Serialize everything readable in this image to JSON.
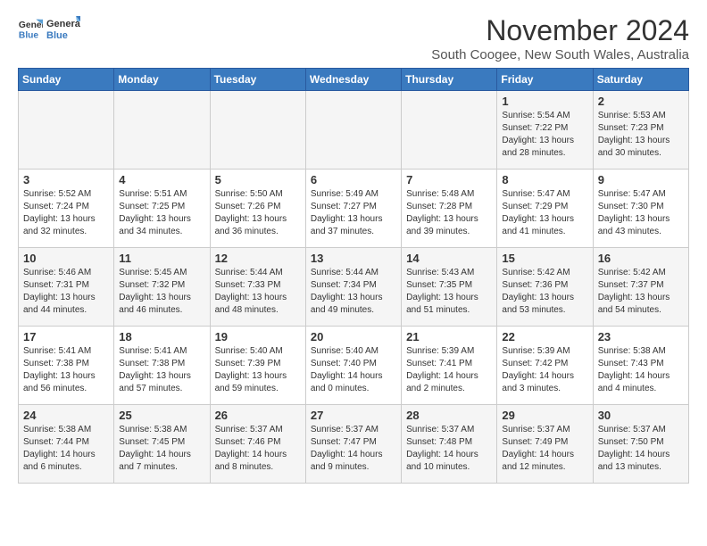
{
  "logo": {
    "general": "General",
    "blue": "Blue"
  },
  "title": "November 2024",
  "subtitle": "South Coogee, New South Wales, Australia",
  "days_of_week": [
    "Sunday",
    "Monday",
    "Tuesday",
    "Wednesday",
    "Thursday",
    "Friday",
    "Saturday"
  ],
  "weeks": [
    [
      {
        "day": "",
        "info": ""
      },
      {
        "day": "",
        "info": ""
      },
      {
        "day": "",
        "info": ""
      },
      {
        "day": "",
        "info": ""
      },
      {
        "day": "",
        "info": ""
      },
      {
        "day": "1",
        "info": "Sunrise: 5:54 AM\nSunset: 7:22 PM\nDaylight: 13 hours\nand 28 minutes."
      },
      {
        "day": "2",
        "info": "Sunrise: 5:53 AM\nSunset: 7:23 PM\nDaylight: 13 hours\nand 30 minutes."
      }
    ],
    [
      {
        "day": "3",
        "info": "Sunrise: 5:52 AM\nSunset: 7:24 PM\nDaylight: 13 hours\nand 32 minutes."
      },
      {
        "day": "4",
        "info": "Sunrise: 5:51 AM\nSunset: 7:25 PM\nDaylight: 13 hours\nand 34 minutes."
      },
      {
        "day": "5",
        "info": "Sunrise: 5:50 AM\nSunset: 7:26 PM\nDaylight: 13 hours\nand 36 minutes."
      },
      {
        "day": "6",
        "info": "Sunrise: 5:49 AM\nSunset: 7:27 PM\nDaylight: 13 hours\nand 37 minutes."
      },
      {
        "day": "7",
        "info": "Sunrise: 5:48 AM\nSunset: 7:28 PM\nDaylight: 13 hours\nand 39 minutes."
      },
      {
        "day": "8",
        "info": "Sunrise: 5:47 AM\nSunset: 7:29 PM\nDaylight: 13 hours\nand 41 minutes."
      },
      {
        "day": "9",
        "info": "Sunrise: 5:47 AM\nSunset: 7:30 PM\nDaylight: 13 hours\nand 43 minutes."
      }
    ],
    [
      {
        "day": "10",
        "info": "Sunrise: 5:46 AM\nSunset: 7:31 PM\nDaylight: 13 hours\nand 44 minutes."
      },
      {
        "day": "11",
        "info": "Sunrise: 5:45 AM\nSunset: 7:32 PM\nDaylight: 13 hours\nand 46 minutes."
      },
      {
        "day": "12",
        "info": "Sunrise: 5:44 AM\nSunset: 7:33 PM\nDaylight: 13 hours\nand 48 minutes."
      },
      {
        "day": "13",
        "info": "Sunrise: 5:44 AM\nSunset: 7:34 PM\nDaylight: 13 hours\nand 49 minutes."
      },
      {
        "day": "14",
        "info": "Sunrise: 5:43 AM\nSunset: 7:35 PM\nDaylight: 13 hours\nand 51 minutes."
      },
      {
        "day": "15",
        "info": "Sunrise: 5:42 AM\nSunset: 7:36 PM\nDaylight: 13 hours\nand 53 minutes."
      },
      {
        "day": "16",
        "info": "Sunrise: 5:42 AM\nSunset: 7:37 PM\nDaylight: 13 hours\nand 54 minutes."
      }
    ],
    [
      {
        "day": "17",
        "info": "Sunrise: 5:41 AM\nSunset: 7:38 PM\nDaylight: 13 hours\nand 56 minutes."
      },
      {
        "day": "18",
        "info": "Sunrise: 5:41 AM\nSunset: 7:38 PM\nDaylight: 13 hours\nand 57 minutes."
      },
      {
        "day": "19",
        "info": "Sunrise: 5:40 AM\nSunset: 7:39 PM\nDaylight: 13 hours\nand 59 minutes."
      },
      {
        "day": "20",
        "info": "Sunrise: 5:40 AM\nSunset: 7:40 PM\nDaylight: 14 hours\nand 0 minutes."
      },
      {
        "day": "21",
        "info": "Sunrise: 5:39 AM\nSunset: 7:41 PM\nDaylight: 14 hours\nand 2 minutes."
      },
      {
        "day": "22",
        "info": "Sunrise: 5:39 AM\nSunset: 7:42 PM\nDaylight: 14 hours\nand 3 minutes."
      },
      {
        "day": "23",
        "info": "Sunrise: 5:38 AM\nSunset: 7:43 PM\nDaylight: 14 hours\nand 4 minutes."
      }
    ],
    [
      {
        "day": "24",
        "info": "Sunrise: 5:38 AM\nSunset: 7:44 PM\nDaylight: 14 hours\nand 6 minutes."
      },
      {
        "day": "25",
        "info": "Sunrise: 5:38 AM\nSunset: 7:45 PM\nDaylight: 14 hours\nand 7 minutes."
      },
      {
        "day": "26",
        "info": "Sunrise: 5:37 AM\nSunset: 7:46 PM\nDaylight: 14 hours\nand 8 minutes."
      },
      {
        "day": "27",
        "info": "Sunrise: 5:37 AM\nSunset: 7:47 PM\nDaylight: 14 hours\nand 9 minutes."
      },
      {
        "day": "28",
        "info": "Sunrise: 5:37 AM\nSunset: 7:48 PM\nDaylight: 14 hours\nand 10 minutes."
      },
      {
        "day": "29",
        "info": "Sunrise: 5:37 AM\nSunset: 7:49 PM\nDaylight: 14 hours\nand 12 minutes."
      },
      {
        "day": "30",
        "info": "Sunrise: 5:37 AM\nSunset: 7:50 PM\nDaylight: 14 hours\nand 13 minutes."
      }
    ]
  ],
  "accent_color": "#3a7abf"
}
